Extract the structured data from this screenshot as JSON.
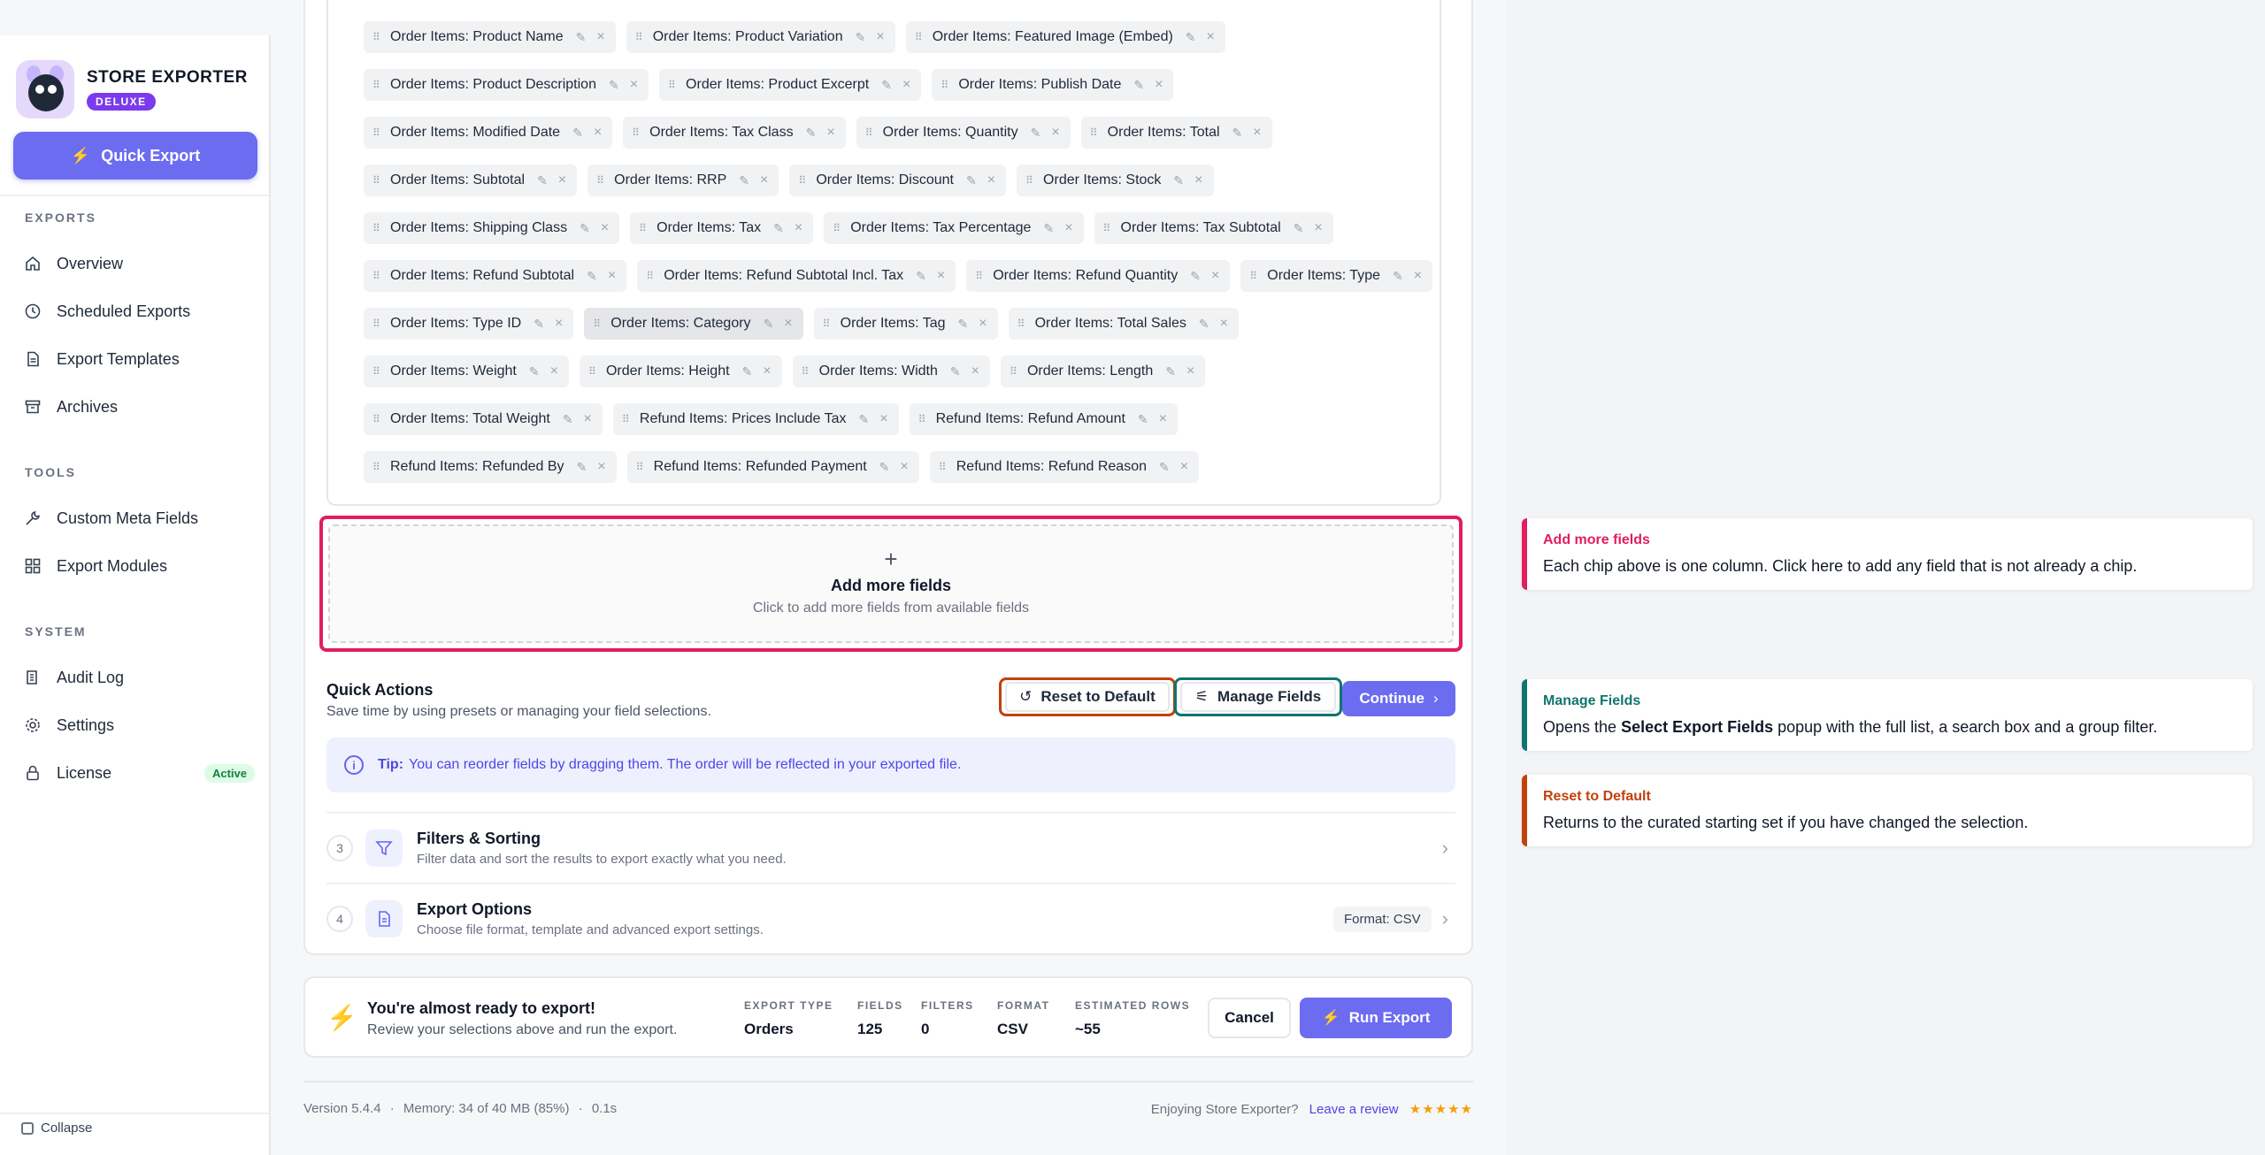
{
  "brand": {
    "name": "STORE EXPORTER",
    "badge": "DELUXE"
  },
  "sidebar": {
    "quick_export": "Quick Export",
    "sections": [
      {
        "label": "EXPORTS",
        "items": [
          {
            "label": "Overview",
            "icon": "home-icon"
          },
          {
            "label": "Scheduled Exports",
            "icon": "clock-icon"
          },
          {
            "label": "Export Templates",
            "icon": "document-icon"
          },
          {
            "label": "Archives",
            "icon": "archive-icon"
          }
        ]
      },
      {
        "label": "TOOLS",
        "items": [
          {
            "label": "Custom Meta Fields",
            "icon": "wrench-icon"
          },
          {
            "label": "Export Modules",
            "icon": "grid-icon"
          }
        ]
      },
      {
        "label": "SYSTEM",
        "items": [
          {
            "label": "Audit Log",
            "icon": "log-icon"
          },
          {
            "label": "Settings",
            "icon": "gear-icon"
          },
          {
            "label": "License",
            "icon": "lock-icon",
            "badge": "Active"
          }
        ]
      }
    ],
    "collapse": "Collapse"
  },
  "chips": [
    [
      "Order Items: Product Name",
      "Order Items: Product Variation",
      "Order Items: Featured Image (Embed)"
    ],
    [
      "Order Items: Product Description",
      "Order Items: Product Excerpt",
      "Order Items: Publish Date"
    ],
    [
      "Order Items: Modified Date",
      "Order Items: Tax Class",
      "Order Items: Quantity",
      "Order Items: Total"
    ],
    [
      "Order Items: Subtotal",
      "Order Items: RRP",
      "Order Items: Discount",
      "Order Items: Stock"
    ],
    [
      "Order Items: Shipping Class",
      "Order Items: Tax",
      "Order Items: Tax Percentage",
      "Order Items: Tax Subtotal"
    ],
    [
      "Order Items: Refund Subtotal",
      "Order Items: Refund Subtotal Incl. Tax",
      "Order Items: Refund Quantity",
      "Order Items: Type"
    ],
    [
      "Order Items: Type ID",
      "Order Items: Category",
      "Order Items: Tag",
      "Order Items: Total Sales"
    ],
    [
      "Order Items: Weight",
      "Order Items: Height",
      "Order Items: Width",
      "Order Items: Length"
    ],
    [
      "Order Items: Total Weight",
      "Refund Items: Prices Include Tax",
      "Refund Items: Refund Amount"
    ],
    [
      "Refund Items: Refunded By",
      "Refund Items: Refunded Payment",
      "Refund Items: Refund Reason"
    ]
  ],
  "add_fields": {
    "plus": "+",
    "title": "Add more fields",
    "subtitle": "Click to add more fields from available fields"
  },
  "quick_actions": {
    "title": "Quick Actions",
    "subtitle": "Save time by using presets or managing your field selections.",
    "reset": "Reset to Default",
    "manage": "Manage Fields",
    "continue": "Continue"
  },
  "tip": {
    "label": "Tip:",
    "text": "You can reorder fields by dragging them. The order will be reflected in your exported file."
  },
  "steps": [
    {
      "num": "3",
      "title": "Filters & Sorting",
      "subtitle": "Filter data and sort the results to export exactly what you need.",
      "icon": "filter-icon"
    },
    {
      "num": "4",
      "title": "Export Options",
      "subtitle": "Choose file format, template and advanced export settings.",
      "icon": "file-icon",
      "format": "Format: CSV"
    }
  ],
  "ready": {
    "title": "You're almost ready to export!",
    "subtitle": "Review your selections above and run the export.",
    "stats": [
      {
        "label": "EXPORT TYPE",
        "value": "Orders"
      },
      {
        "label": "FIELDS",
        "value": "125"
      },
      {
        "label": "FILTERS",
        "value": "0"
      },
      {
        "label": "FORMAT",
        "value": "CSV"
      },
      {
        "label": "ESTIMATED ROWS",
        "value": "~55"
      }
    ],
    "cancel": "Cancel",
    "run": "Run Export"
  },
  "footer": {
    "version": "Version 5.4.4",
    "memory": "Memory: 34 of 40 MB (85%)",
    "time": "0.1s",
    "enjoying": "Enjoying Store Exporter?",
    "review": "Leave a review",
    "stars": "★★★★★"
  },
  "notes": {
    "add": {
      "title": "Add more fields",
      "body": "Each chip above is one column. Click here to add any field that is not already a chip."
    },
    "manage": {
      "title": "Manage Fields",
      "body_pre": "Opens the ",
      "body_bold": "Select Export Fields",
      "body_post": " popup with the full list, a search box and a group filter."
    },
    "reset": {
      "title": "Reset to Default",
      "body": "Returns to the curated starting set if you have changed the selection."
    }
  },
  "colors": {
    "accent": "#6b6cf0",
    "pink": "#e11d63",
    "teal": "#0f766e",
    "orange": "#c2410c"
  }
}
